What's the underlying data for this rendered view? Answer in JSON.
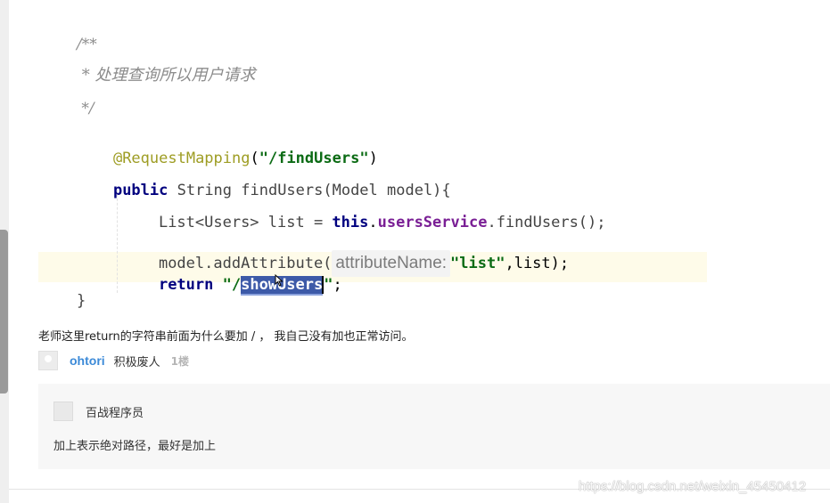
{
  "code": {
    "comment_open": "/**",
    "comment_text": " * 处理查询所以用户请求",
    "comment_close": " */",
    "annotation": "@RequestMapping",
    "annotation_paren_open": "(",
    "annotation_value": "\"/findUsers\"",
    "annotation_paren_close": ")",
    "kw_public": "public",
    "signature": " String findUsers(Model model){",
    "line6_a": "List<Users> list = ",
    "kw_this": "this",
    "line6_dot": ".",
    "field": "usersService",
    "line6_b": ".findUsers();",
    "line7_a": "model.addAttribute(",
    "param_hint": "attributeName:",
    "line7_str": "\"list\"",
    "line7_b": ",list);",
    "kw_return": "return",
    "return_str_open": " \"/",
    "return_selected": "showUsers",
    "return_str_close": "\"",
    "return_end": ";",
    "closing_brace": "}"
  },
  "question": "老师这里return的字符串前面为什么要加 / ， 我自己没有加也正常访问。",
  "comment": {
    "author": "ohtori",
    "nickname": "积极废人",
    "floor": "1楼"
  },
  "reply": {
    "author": "百战程序员",
    "text": "加上表示绝对路径，最好是加上"
  },
  "watermark": "https://blog.csdn.net/weixin_45450412",
  "icons": {
    "scrollbar": "scrollbar-thumb",
    "cursor": "mouse-pointer-icon",
    "avatar": "user-avatar-icon"
  }
}
